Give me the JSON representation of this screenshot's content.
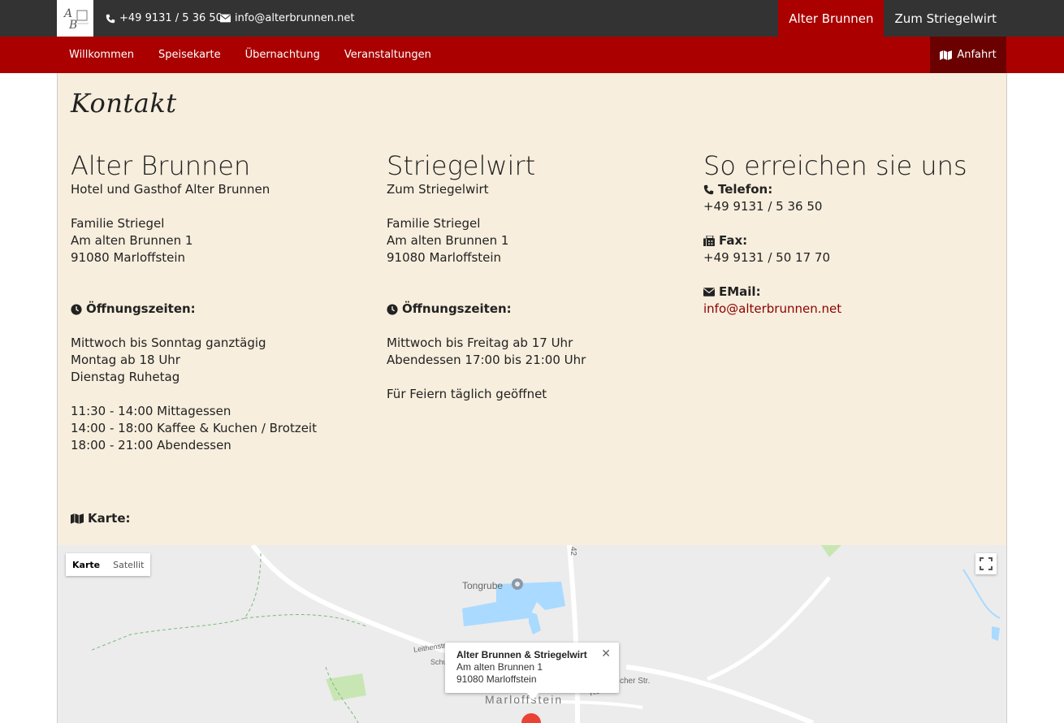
{
  "header": {
    "phone": "+49 9131 / 5 36 50",
    "email": "info@alterbrunnen.net",
    "tabs": [
      {
        "label": "Alter Brunnen",
        "active": true
      },
      {
        "label": "Zum Striegelwirt",
        "active": false
      }
    ]
  },
  "nav": {
    "items": [
      "Willkommen",
      "Speisekarte",
      "Übernachtung",
      "Veranstaltungen"
    ],
    "anfahrt": "Anfahrt"
  },
  "page": {
    "title": "Kontakt"
  },
  "alter_brunnen": {
    "heading": "Alter Brunnen",
    "subtitle": "Hotel und Gasthof Alter Brunnen",
    "address": [
      "Familie Striegel",
      "Am alten Brunnen 1",
      "91080 Marloffstein"
    ],
    "hours_label": "Öffnungszeiten:",
    "hours": [
      "Mittwoch bis Sonntag ganztägig",
      "Montag ab 18 Uhr",
      "Dienstag Ruhetag"
    ],
    "times": [
      "11:30 - 14:00 Mittagessen",
      "14:00 - 18:00 Kaffee & Kuchen / Brotzeit",
      "18:00 - 21:00 Abendessen"
    ]
  },
  "striegelwirt": {
    "heading": "Striegelwirt",
    "subtitle": "Zum Striegelwirt",
    "address": [
      "Familie Striegel",
      "Am alten Brunnen 1",
      "91080 Marloffstein"
    ],
    "hours_label": "Öffnungszeiten:",
    "hours": [
      "Mittwoch bis Freitag ab 17 Uhr",
      "Abendessen 17:00 bis 21:00 Uhr"
    ],
    "note": "Für Feiern täglich geöffnet"
  },
  "reach": {
    "heading": "So erreichen sie uns",
    "phone_label": "Telefon:",
    "phone": "+49 9131 / 5 36 50",
    "fax_label": "Fax:",
    "fax": "+49 9131 / 50 17 70",
    "email_label": "EMail:",
    "email": "info@alterbrunnen.net"
  },
  "map": {
    "label": "Karte:",
    "type_map": "Karte",
    "type_satellite": "Satellit",
    "place_tongrube": "Tongrube",
    "road_number": "42",
    "town": "Marloffstein",
    "street_a": "Leithenstr.",
    "street_b": "Schu",
    "street_c": "Ro",
    "street_d": "cher Str.",
    "info_title": "Alter Brunnen & Striegelwirt",
    "info_line1": "Am alten Brunnen 1",
    "info_line2": "91080 Marloffstein",
    "info_close": "✕"
  },
  "colors": {
    "topbar": "#333333",
    "brand_red": "#aa0000",
    "dark_red": "#6b0000",
    "panel": "#f7eedd",
    "link": "#8b0000"
  },
  "icons": {
    "phone": "phone-icon",
    "email": "envelope-icon",
    "map": "map-icon",
    "clock": "clock-icon",
    "fax": "fax-icon",
    "fullscreen": "fullscreen-icon"
  }
}
